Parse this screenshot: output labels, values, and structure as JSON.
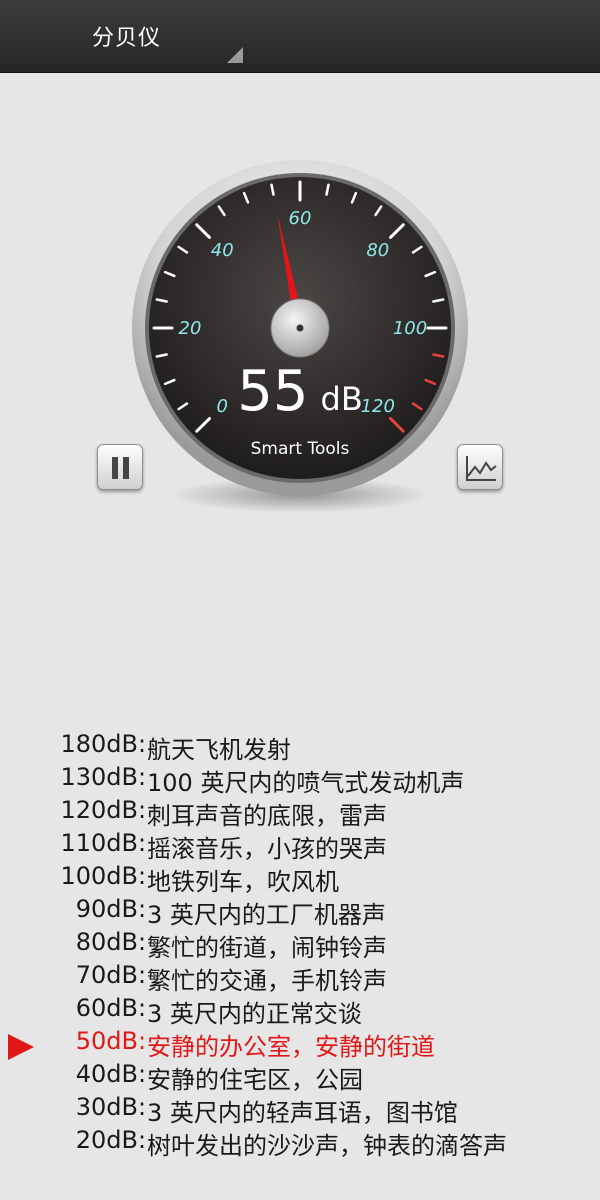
{
  "app": {
    "title": "分贝仪"
  },
  "gauge": {
    "reading_value": "55",
    "reading_unit": "dB",
    "brand": "Smart Tools",
    "scale_labels": [
      "0",
      "20",
      "40",
      "60",
      "80",
      "100",
      "120"
    ],
    "scale_min": 0,
    "scale_max": 120,
    "needle_value": 55,
    "colors": {
      "needle": "#e3141a",
      "label": "#8ee6ea",
      "danger": "#e64040"
    }
  },
  "controls": {
    "pause_icon": "pause-icon",
    "chart_icon": "line-chart-icon"
  },
  "legend": {
    "items": [
      {
        "db": "180dB",
        "sep": ":",
        "desc": "航天飞机发射"
      },
      {
        "db": "130dB",
        "sep": ":",
        "desc": "100 英尺内的喷气式发动机声"
      },
      {
        "db": "120dB",
        "sep": ":",
        "desc": "刺耳声音的底限，雷声"
      },
      {
        "db": "110dB",
        "sep": ":",
        "desc": "摇滚音乐，小孩的哭声"
      },
      {
        "db": "100dB",
        "sep": ":",
        "desc": "地铁列车，吹风机"
      },
      {
        "db": "90dB",
        "sep": ":",
        "desc": "3 英尺内的工厂机器声"
      },
      {
        "db": "80dB",
        "sep": ":",
        "desc": "繁忙的街道，闹钟铃声"
      },
      {
        "db": "70dB",
        "sep": ":",
        "desc": "繁忙的交通，手机铃声"
      },
      {
        "db": "60dB",
        "sep": ":",
        "desc": "3 英尺内的正常交谈"
      },
      {
        "db": "50dB",
        "sep": ":",
        "desc": "安静的办公室，安静的街道"
      },
      {
        "db": "40dB",
        "sep": ":",
        "desc": "安静的住宅区，公园"
      },
      {
        "db": "30dB",
        "sep": ":",
        "desc": "3 英尺内的轻声耳语，图书馆"
      },
      {
        "db": "20dB",
        "sep": ":",
        "desc": "树叶发出的沙沙声，钟表的滴答声"
      }
    ],
    "active_index": 9
  }
}
